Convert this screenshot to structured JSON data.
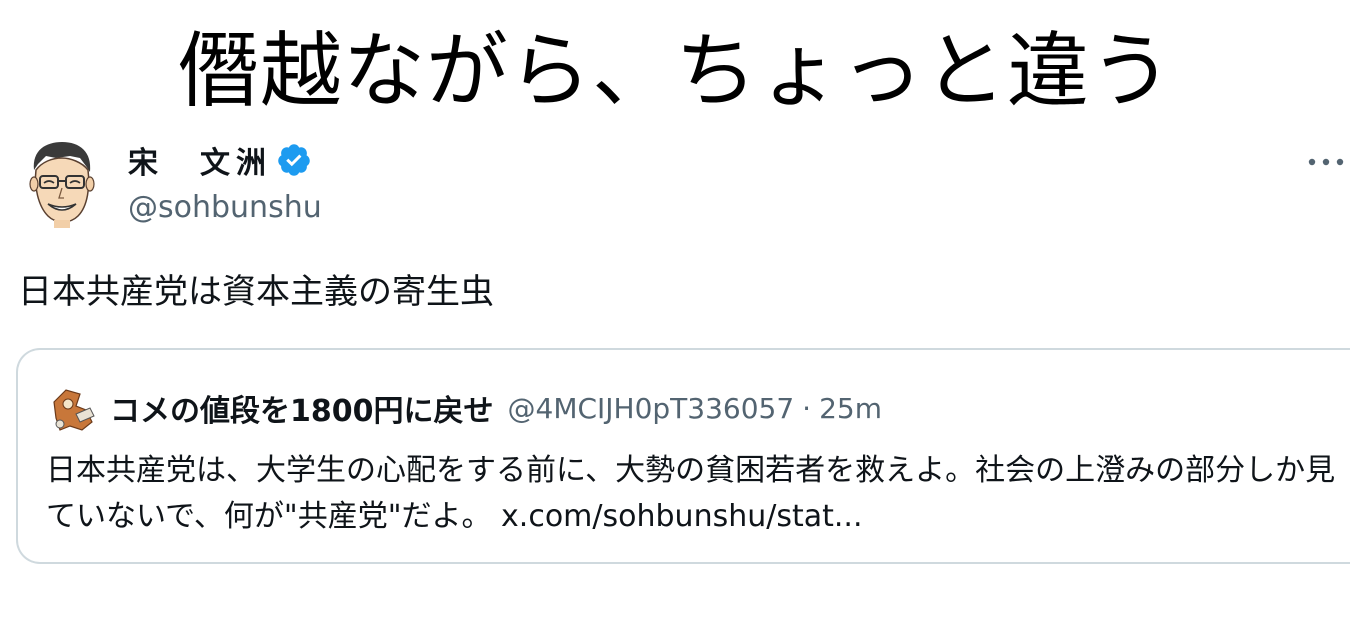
{
  "caption": "僭越ながら、ちょっと違う",
  "tweet": {
    "author": {
      "display_name": "宋　文洲",
      "handle": "@sohbunshu",
      "verified": true
    },
    "text": "日本共産党は資本主義の寄生虫",
    "quoted": {
      "author_name": "コメの値段を1800円に戻せ",
      "handle": "@4MCIJH0pT336057",
      "separator": "·",
      "time": "25m",
      "text": "日本共産党は、大学生の心配をする前に、大勢の貧困若者を救えよ。社会の上澄みの部分しか見ていないで、何が\"共産党\"だよ。",
      "link": "x.com/sohbunshu/stat..."
    }
  },
  "colors": {
    "verified_blue": "#1d9bf0",
    "muted_text": "#536471",
    "border": "#cfd9de"
  },
  "icons": {
    "verified": "verified-badge-icon",
    "more": "more-dots-icon"
  }
}
